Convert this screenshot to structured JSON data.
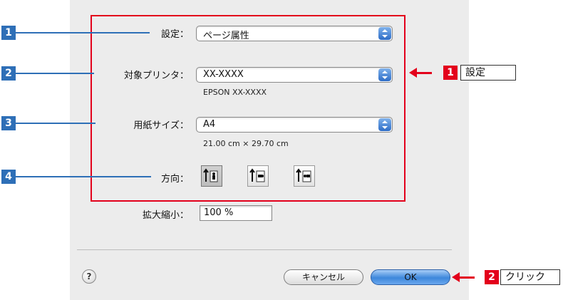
{
  "callouts": {
    "left": [
      "1",
      "2",
      "3",
      "4"
    ],
    "right1": {
      "num": "1",
      "text": "設定"
    },
    "right2": {
      "num": "2",
      "text": "クリック"
    }
  },
  "fields": {
    "settings": {
      "label": "設定：",
      "value": "ページ属性"
    },
    "printer": {
      "label": "対象プリンタ：",
      "value": "XX-XXXX",
      "sub": "EPSON XX-XXXX"
    },
    "paper": {
      "label": "用紙サイズ：",
      "value": "A4",
      "sub": "21.00 cm × 29.70 cm"
    },
    "orientation": {
      "label": "方向：",
      "options": [
        "portrait",
        "landscape-left",
        "landscape-right"
      ],
      "selected": "portrait"
    },
    "scale": {
      "label": "拡大縮小：",
      "value": "100 %"
    }
  },
  "buttons": {
    "help": "?",
    "cancel": "キャンセル",
    "ok": "OK"
  },
  "colors": {
    "callout_red": "#e3001b",
    "callout_blue": "#2e6fb7",
    "dialog_bg": "#ececec"
  }
}
